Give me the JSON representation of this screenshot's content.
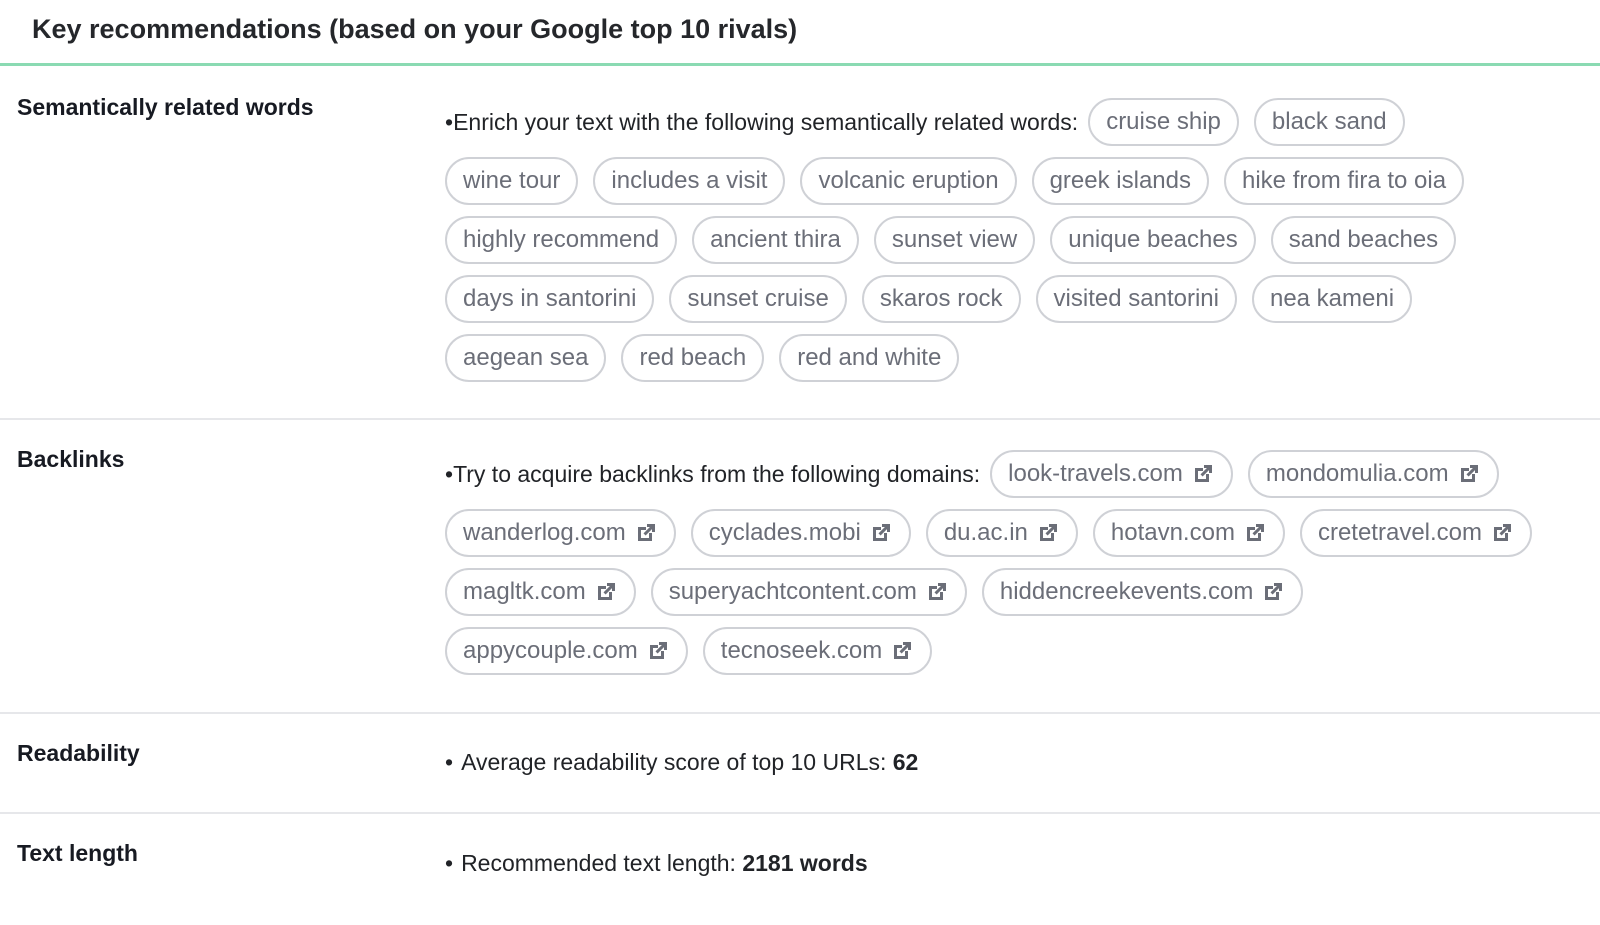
{
  "header": {
    "title": "Key recommendations (based on your Google top 10 rivals)"
  },
  "colors": {
    "accent": "#8adab2",
    "tag_text": "#6b6e78",
    "tag_border": "#cfd1d6"
  },
  "semantic": {
    "label": "Semantically related words",
    "bullet": "•",
    "intro": "Enrich your text with the following semantically related words:",
    "tags": [
      "cruise ship",
      "black sand",
      "wine tour",
      "includes a visit",
      "volcanic eruption",
      "greek islands",
      "hike from fira to oia",
      "highly recommend",
      "ancient thira",
      "sunset view",
      "unique beaches",
      "sand beaches",
      "days in santorini",
      "sunset cruise",
      "skaros rock",
      "visited santorini",
      "nea kameni",
      "aegean sea",
      "red beach",
      "red and white"
    ]
  },
  "backlinks": {
    "label": "Backlinks",
    "bullet": "•",
    "intro": "Try to acquire backlinks from the following domains:",
    "icon": "external-link-icon",
    "domains": [
      "look-travels.com",
      "mondomulia.com",
      "wanderlog.com",
      "cyclades.mobi",
      "du.ac.in",
      "hotavn.com",
      "cretetravel.com",
      "magltk.com",
      "superyachtcontent.com",
      "hiddencreekevents.com",
      "appycouple.com",
      "tecnoseek.com"
    ]
  },
  "readability": {
    "label": "Readability",
    "bullet": "•",
    "text": "Average readability score of top 10 URLs:",
    "value": "62"
  },
  "text_length": {
    "label": "Text length",
    "bullet": "•",
    "text": "Recommended text length:",
    "value": "2181 words"
  }
}
